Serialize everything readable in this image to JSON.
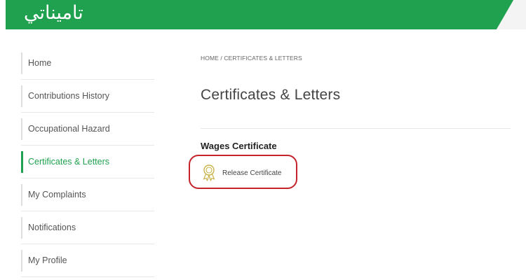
{
  "header": {
    "logo_text": "تاميناتي"
  },
  "sidebar": {
    "items": [
      {
        "label": "Home"
      },
      {
        "label": "Contributions History"
      },
      {
        "label": "Occupational Hazard"
      },
      {
        "label": "Certificates & Letters",
        "active": true
      },
      {
        "label": "My Complaints"
      },
      {
        "label": "Notifications"
      },
      {
        "label": "My Profile"
      }
    ]
  },
  "breadcrumb": {
    "home": "HOME",
    "separator": "/",
    "current": "CERTIFICATES & LETTERS"
  },
  "main": {
    "title": "Certificates & Letters",
    "section_title": "Wages Certificate",
    "link_label": "Release Certificate",
    "link_icon": "certificate-ribbon-icon"
  },
  "colors": {
    "brand": "#1fa14f",
    "highlight": "#c4232b",
    "icon": "#c9b24a"
  }
}
